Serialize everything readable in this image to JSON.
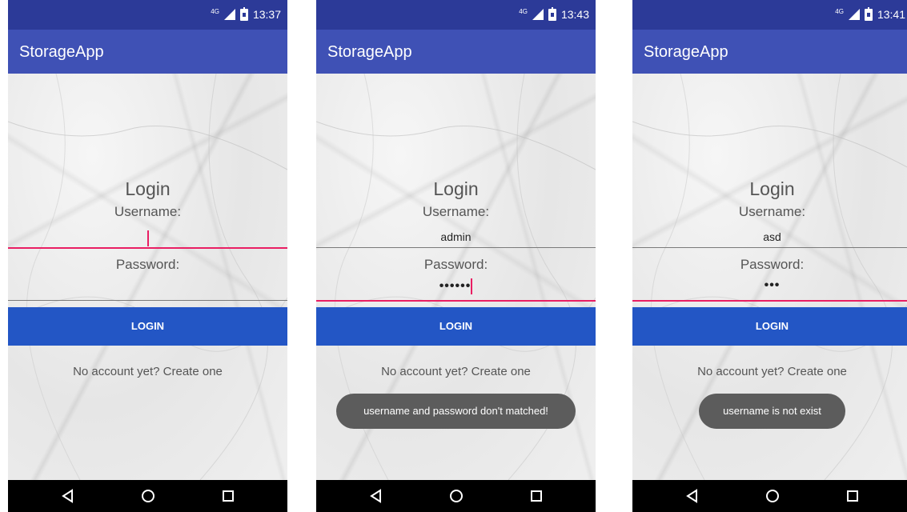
{
  "screens": [
    {
      "status": {
        "network": "4G",
        "time": "13:37"
      },
      "app_title": "StorageApp",
      "form": {
        "title": "Login",
        "username_label": "Username:",
        "username_value": "",
        "password_label": "Password:",
        "password_value": "",
        "focused": "username"
      },
      "login_button": "LOGIN",
      "create_link": "No account yet? Create one",
      "toast": ""
    },
    {
      "status": {
        "network": "4G",
        "time": "13:43"
      },
      "app_title": "StorageApp",
      "form": {
        "title": "Login",
        "username_label": "Username:",
        "username_value": "admin",
        "password_label": "Password:",
        "password_value": "••••••",
        "focused": "password"
      },
      "login_button": "LOGIN",
      "create_link": "No account yet? Create one",
      "toast": "username and password don't matched!"
    },
    {
      "status": {
        "network": "4G",
        "time": "13:41"
      },
      "app_title": "StorageApp",
      "form": {
        "title": "Login",
        "username_label": "Username:",
        "username_value": "asd",
        "password_label": "Password:",
        "password_value": "•••",
        "focused": "password"
      },
      "login_button": "LOGIN",
      "create_link": "No account yet? Create one",
      "toast": "username is not exist"
    }
  ],
  "icons": {
    "status": [
      "signal-icon",
      "battery-charging-icon"
    ],
    "nav": [
      "back-icon",
      "home-icon",
      "recents-icon"
    ]
  },
  "colors": {
    "status_bar": "#2c3a98",
    "app_bar": "#3f51b5",
    "accent": "#e91e63",
    "button": "#2356c5",
    "toast": "#5c5c5c",
    "nav_bar": "#000000"
  }
}
